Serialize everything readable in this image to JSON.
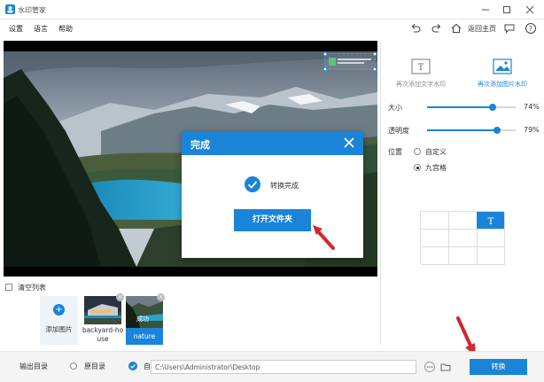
{
  "window": {
    "title": "水印管家"
  },
  "menu": {
    "items": [
      "设置",
      "语言",
      "帮助"
    ]
  },
  "toolbar": {
    "home_label": "返回主页"
  },
  "dialog": {
    "title": "完成",
    "message": "转换完成",
    "open_folder_label": "打开文件夹"
  },
  "right_panel": {
    "add_text_label": "再次添加文字水印",
    "add_image_label": "再次添加图片水印",
    "size": {
      "label": "大小",
      "value": 0.74,
      "value_label": "74%"
    },
    "opacity": {
      "label": "透明度",
      "value": 0.79,
      "value_label": "79%"
    },
    "position": {
      "label": "位置",
      "options": [
        "自定义",
        "九宫格"
      ],
      "selected": "九宫格"
    },
    "nine_grid_selected": [
      0,
      2
    ]
  },
  "list": {
    "clear_label": "清空列表",
    "add_label": "添加图片",
    "items": [
      {
        "name": "backyard-house",
        "selected": false,
        "badge": ""
      },
      {
        "name": "nature",
        "selected": true,
        "badge": "成功"
      }
    ]
  },
  "output": {
    "label": "输出目录",
    "options": [
      "原目录",
      "自定义"
    ],
    "selected": "自定义",
    "path": "C:\\Users\\Administrator\\Desktop",
    "convert_label": "转换"
  },
  "colors": {
    "accent": "#1a84d8",
    "arrow": "#d4262b"
  }
}
